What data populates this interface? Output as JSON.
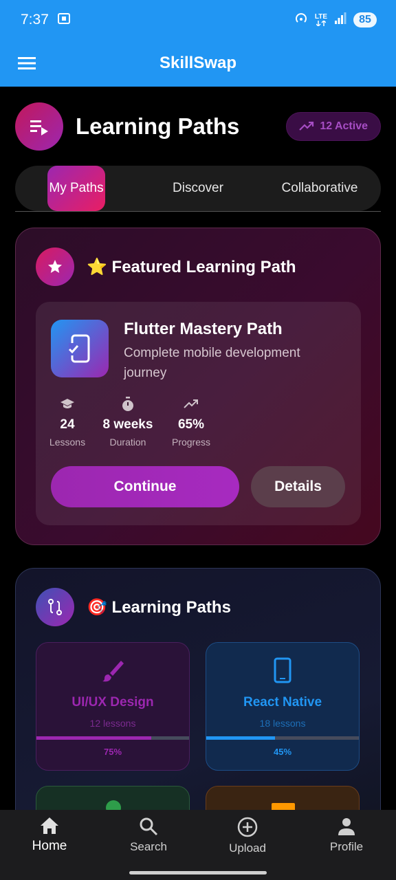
{
  "status_bar": {
    "time": "7:37",
    "network": "LTE",
    "battery": "85"
  },
  "app_bar": {
    "title": "SkillSwap"
  },
  "header": {
    "title": "Learning Paths",
    "active_badge": "12 Active"
  },
  "tabs": [
    {
      "label": "My Paths",
      "selected": true
    },
    {
      "label": "Discover",
      "selected": false
    },
    {
      "label": "Collaborative",
      "selected": false
    }
  ],
  "featured": {
    "section_title": "⭐ Featured Learning Path",
    "path_title": "Flutter Mastery Path",
    "path_description": "Complete mobile development journey",
    "stats": [
      {
        "icon": "graduation-cap-icon",
        "value": "24",
        "label": "Lessons"
      },
      {
        "icon": "timer-icon",
        "value": "8 weeks",
        "label": "Duration"
      },
      {
        "icon": "trending-up-icon",
        "value": "65%",
        "label": "Progress"
      }
    ],
    "continue_label": "Continue",
    "details_label": "Details"
  },
  "paths_section": {
    "section_title": "🎯 Learning Paths",
    "items": [
      {
        "title": "UI/UX Design",
        "lessons": "12 lessons",
        "progress_text": "75%",
        "progress": 0.75,
        "color": "#9c27b0",
        "icon": "brush-icon"
      },
      {
        "title": "React Native",
        "lessons": "18 lessons",
        "progress_text": "45%",
        "progress": 0.45,
        "color": "#2196f3",
        "icon": "phone-icon"
      }
    ]
  },
  "bottom_nav": [
    {
      "label": "Home",
      "icon": "home-icon",
      "active": true
    },
    {
      "label": "Search",
      "icon": "search-icon",
      "active": false
    },
    {
      "label": "Upload",
      "icon": "add-circle-icon",
      "active": false
    },
    {
      "label": "Profile",
      "icon": "person-icon",
      "active": false
    }
  ],
  "colors": {
    "primary": "#2196f3",
    "accent_purple": "#9c27b0",
    "accent_pink": "#e91e63"
  }
}
